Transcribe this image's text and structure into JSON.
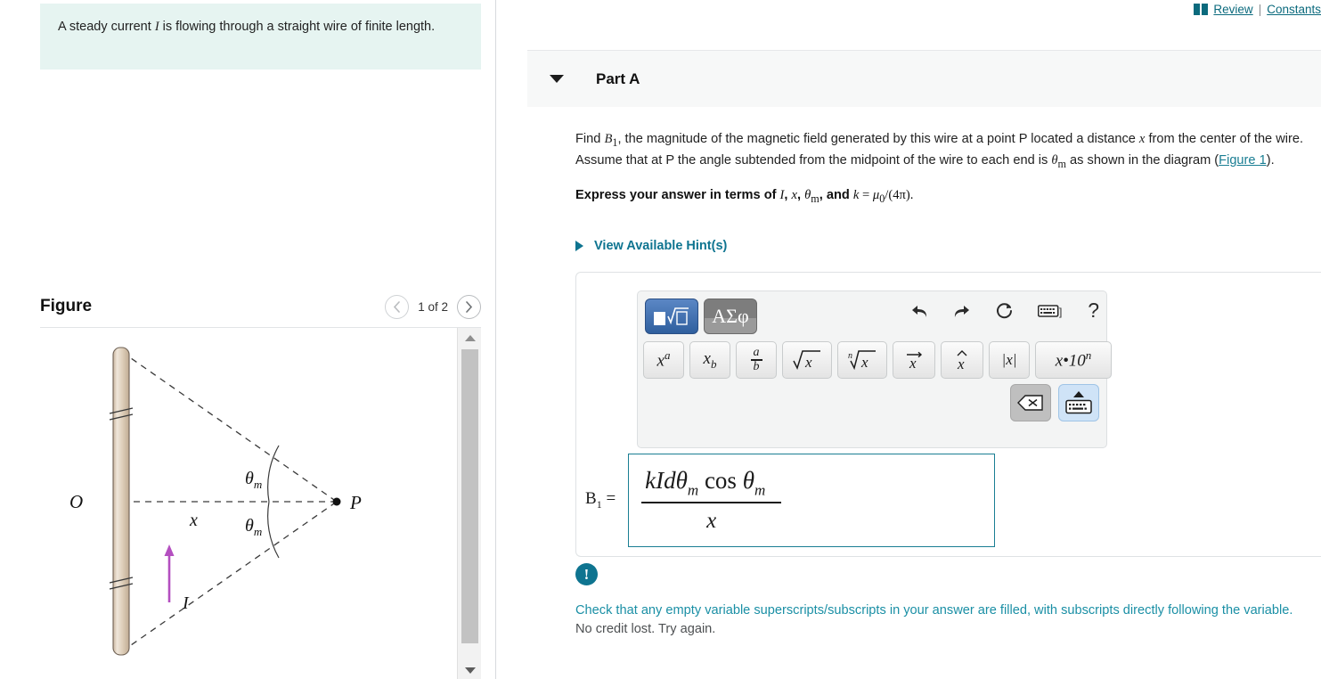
{
  "topbar": {
    "book_icon": "book-icon",
    "review_label": "Review",
    "separator": "|",
    "constants_label": "Constants"
  },
  "left_panel": {
    "intro_prefix": "A steady current ",
    "intro_var": "I",
    "intro_suffix": " is flowing through a straight wire of finite length.",
    "figure": {
      "title": "Figure",
      "prev_icon": "chevron-left-icon",
      "next_icon": "chevron-right-icon",
      "page_count": "1 of 2",
      "diagram": {
        "label_origin": "O",
        "label_point": "P",
        "label_distance": "x",
        "label_angle_top": "θ",
        "label_angle_top_sub": "m",
        "label_angle_bottom": "θ",
        "label_angle_bottom_sub": "m",
        "label_current": "I",
        "wire_color": "#d6c4b0",
        "current_arrow_color": "#b44fc0",
        "dashed_line_color": "#3a3a3a"
      },
      "scrollbar": {
        "up_icon": "scroll-up-arrow-icon",
        "down_icon": "scroll-down-arrow-icon"
      }
    }
  },
  "part": {
    "collapse_icon": "caret-down-icon",
    "title": "Part A",
    "question": {
      "line1_a": "Find ",
      "b1": "B",
      "b1_sub": "1",
      "line1_b": ", the magnitude of the magnetic field generated by this wire at a point P located a distance ",
      "var_x": "x",
      "line1_c": " from the center of the wire. Assume that at P the angle subtended from the midpoint of the wire to each end is ",
      "theta": "θ",
      "theta_sub": "m",
      "line1_d": " as shown in the diagram (",
      "figure_link": "Figure 1",
      "line1_e": ").",
      "express_prefix": "Express your answer in terms of ",
      "express_I": "I",
      "express_comma1": ", ",
      "express_x": "x",
      "express_comma2": ", ",
      "express_theta": "θ",
      "express_theta_sub": "m",
      "express_and": ", and ",
      "express_k": "k",
      "express_eq": " = ",
      "express_mu": "μ",
      "express_mu_sub": "0",
      "express_tail": "/(4π)."
    },
    "hints": {
      "expand_icon": "triangle-right-icon",
      "label": "View Available Hint(s)"
    }
  },
  "math_toolbar": {
    "mode_math": {
      "name": "math-template-mode-button",
      "icon": "square-radical-box-icon",
      "active": true,
      "color": "#2f5f9e"
    },
    "mode_greek": {
      "name": "greek-symbols-mode-button",
      "label": "ΑΣφ",
      "active": false
    },
    "actions": [
      {
        "name": "undo-icon",
        "glyph": "↰"
      },
      {
        "name": "redo-icon",
        "glyph": "↱"
      },
      {
        "name": "reset-icon",
        "glyph": "↻"
      },
      {
        "name": "keyboard-icon",
        "glyph": "⌨"
      },
      {
        "name": "help-icon",
        "glyph": "?"
      }
    ],
    "operators": [
      {
        "name": "superscript-button",
        "label": "xᵃ"
      },
      {
        "name": "subscript-button",
        "label": "x_b"
      },
      {
        "name": "fraction-button",
        "label": "a/b"
      },
      {
        "name": "square-root-button",
        "label": "√x"
      },
      {
        "name": "nth-root-button",
        "label": "ⁿ√x"
      },
      {
        "name": "vector-button",
        "label": "x⃗"
      },
      {
        "name": "unit-vector-button",
        "label": "x̂"
      },
      {
        "name": "absolute-value-button",
        "label": "|x|"
      },
      {
        "name": "scientific-notation-button",
        "label": "x·10ⁿ"
      }
    ],
    "backspace": {
      "name": "backspace-button",
      "glyph": "⌫"
    },
    "keyboard_toggle": {
      "name": "keyboard-toggle-button",
      "glyph": "⌨"
    }
  },
  "answer": {
    "label_b": "B",
    "label_sub": "1",
    "label_eq": "=",
    "numerator_a": "kIdθ",
    "numerator_sub1": "m",
    "numerator_cos": " cos ",
    "numerator_theta": "θ",
    "numerator_sub2": "m",
    "denominator": "x",
    "border_color": "#1a7e93"
  },
  "feedback": {
    "icon": "exclamation-circle-icon",
    "icon_glyph": "!",
    "message": "Check that any empty variable superscripts/subscripts in your answer are filled, with subscripts directly following the variable.",
    "sub_message": "No credit lost. Try again.",
    "message_color": "#1a8fa5"
  }
}
